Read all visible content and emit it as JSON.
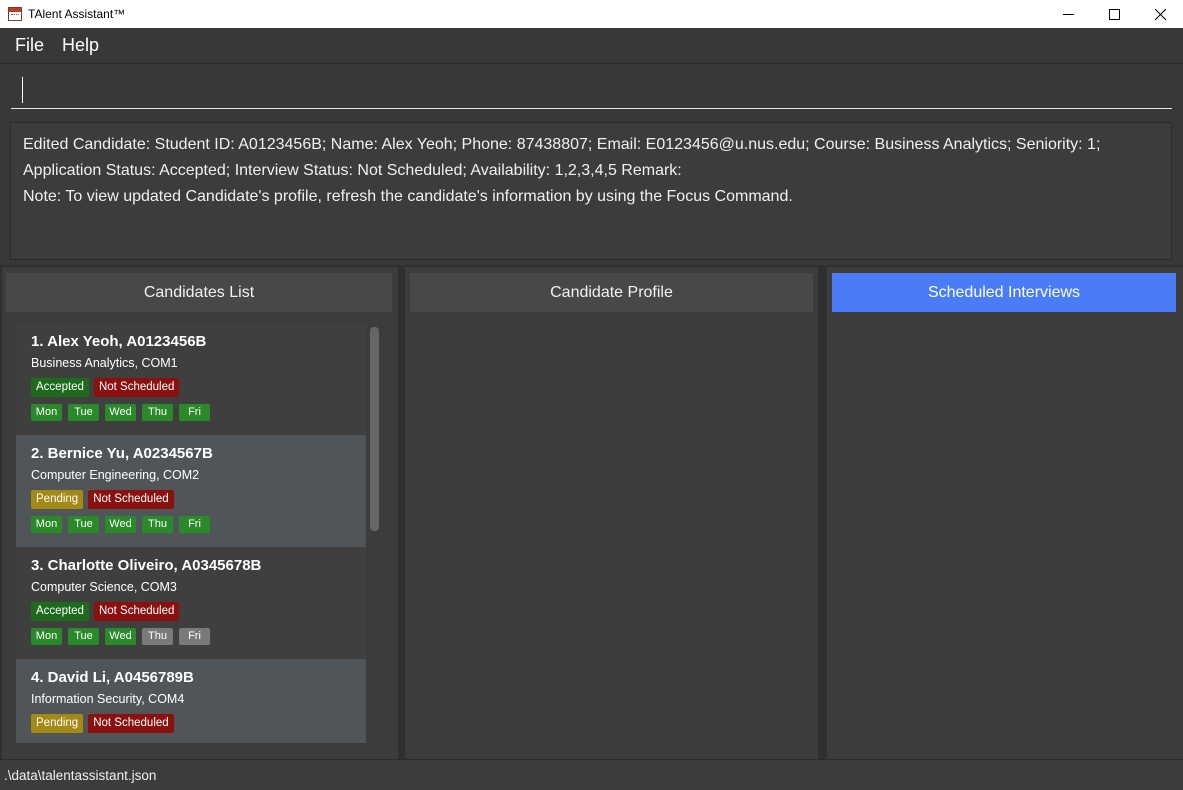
{
  "window": {
    "title": "TAlent Assistant™",
    "controls": {
      "minimize": "—",
      "maximize": "☐",
      "close": "✕"
    }
  },
  "menu": {
    "items": [
      "File",
      "Help"
    ]
  },
  "command_box": {
    "value": ""
  },
  "result": {
    "lines": [
      "Edited Candidate: Student ID: A0123456B; Name: Alex Yeoh; Phone: 87438807; Email: E0123456@u.nus.edu; Course: Business Analytics; Seniority: 1;",
      "Application Status: Accepted; Interview Status: Not Scheduled; Availability: 1,2,3,4,5 Remark:",
      "Note: To view updated Candidate's profile, refresh the candidate's information by using the Focus Command."
    ]
  },
  "panels": {
    "candidates_list": "Candidates List",
    "candidate_profile": "Candidate Profile",
    "scheduled_interviews": "Scheduled Interviews"
  },
  "candidates": [
    {
      "name": "1.  Alex Yeoh, A0123456B",
      "subtitle": "Business Analytics, COM1",
      "app_status": "Accepted",
      "interview_status": "Not Scheduled",
      "days": [
        {
          "label": "Mon",
          "available": true
        },
        {
          "label": "Tue",
          "available": true
        },
        {
          "label": "Wed",
          "available": true
        },
        {
          "label": "Thu",
          "available": true
        },
        {
          "label": "Fri",
          "available": true
        }
      ]
    },
    {
      "name": "2.  Bernice Yu, A0234567B",
      "subtitle": "Computer Engineering, COM2",
      "app_status": "Pending",
      "interview_status": "Not Scheduled",
      "days": [
        {
          "label": "Mon",
          "available": true
        },
        {
          "label": "Tue",
          "available": true
        },
        {
          "label": "Wed",
          "available": true
        },
        {
          "label": "Thu",
          "available": true
        },
        {
          "label": "Fri",
          "available": true
        }
      ]
    },
    {
      "name": "3.  Charlotte Oliveiro, A0345678B",
      "subtitle": "Computer Science, COM3",
      "app_status": "Accepted",
      "interview_status": "Not Scheduled",
      "days": [
        {
          "label": "Mon",
          "available": true
        },
        {
          "label": "Tue",
          "available": true
        },
        {
          "label": "Wed",
          "available": true
        },
        {
          "label": "Thu",
          "available": false
        },
        {
          "label": "Fri",
          "available": false
        }
      ]
    },
    {
      "name": "4.  David Li, A0456789B",
      "subtitle": "Information Security, COM4",
      "app_status": "Pending",
      "interview_status": "Not Scheduled",
      "days": []
    }
  ],
  "statusbar": {
    "path": ".\\data\\talentassistant.json"
  },
  "colors": {
    "accent": "#4a7cf8",
    "accepted": "#1e6b1e",
    "pending": "#a48a14",
    "not_scheduled": "#8b1111",
    "day_available": "#2a8a2a",
    "day_unavailable": "#7a7a7a"
  }
}
